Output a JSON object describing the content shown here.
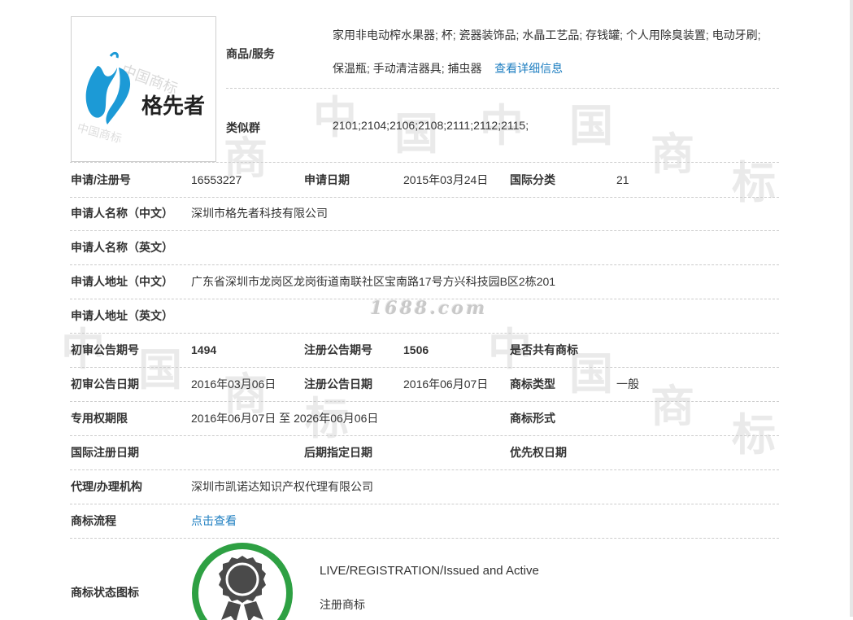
{
  "logo": {
    "brand_text": "格先者",
    "watermark": "中国商标"
  },
  "watermark_site": "1688.com",
  "goods": {
    "label": "商品/服务",
    "text": "家用非电动榨水果器; 杯; 瓷器装饰品; 水晶工艺品; 存钱罐; 个人用除臭装置; 电动牙刷; 保温瓶; 手动清洁器具; 捕虫器",
    "detail_link": "查看详细信息"
  },
  "similar": {
    "label": "类似群",
    "value": "2101;2104;2106;2108;2111;2112;2115;"
  },
  "rows": {
    "reg_no": {
      "label": "申请/注册号",
      "value": "16553227"
    },
    "app_date": {
      "label": "申请日期",
      "value": "2015年03月24日"
    },
    "intl_class": {
      "label": "国际分类",
      "value": "21"
    },
    "applicant_cn": {
      "label": "申请人名称（中文）",
      "value": "深圳市格先者科技有限公司"
    },
    "applicant_en": {
      "label": "申请人名称（英文）",
      "value": ""
    },
    "address_cn": {
      "label": "申请人地址（中文）",
      "value": "广东省深圳市龙岗区龙岗街道南联社区宝南路17号方兴科技园B区2栋201"
    },
    "address_en": {
      "label": "申请人地址（英文）",
      "value": ""
    },
    "prelim_issue": {
      "label": "初审公告期号",
      "value": "1494"
    },
    "reg_issue": {
      "label": "注册公告期号",
      "value": "1506"
    },
    "shared": {
      "label": "是否共有商标",
      "value": ""
    },
    "prelim_date": {
      "label": "初审公告日期",
      "value": "2016年03月06日"
    },
    "reg_date": {
      "label": "注册公告日期",
      "value": "2016年06月07日"
    },
    "tm_type": {
      "label": "商标类型",
      "value": "一般"
    },
    "exclusive": {
      "label": "专用权期限",
      "value": "2016年06月07日 至 2026年06月06日"
    },
    "tm_form": {
      "label": "商标形式",
      "value": ""
    },
    "intl_reg_date": {
      "label": "国际注册日期",
      "value": ""
    },
    "later_date": {
      "label": "后期指定日期",
      "value": ""
    },
    "priority_date": {
      "label": "优先权日期",
      "value": ""
    },
    "agent": {
      "label": "代理/办理机构",
      "value": "深圳市凯诺达知识产权代理有限公司"
    },
    "flow": {
      "label": "商标流程",
      "value": "点击查看"
    }
  },
  "status": {
    "label": "商标状态图标",
    "en": "LIVE/REGISTRATION/Issued and Active",
    "cn": "注册商标",
    "badge_color": "#2ea043",
    "medal_color": "#4a4a4a"
  },
  "colors": {
    "link": "#1f7fc1",
    "logo_blue": "#1c9ad6"
  }
}
